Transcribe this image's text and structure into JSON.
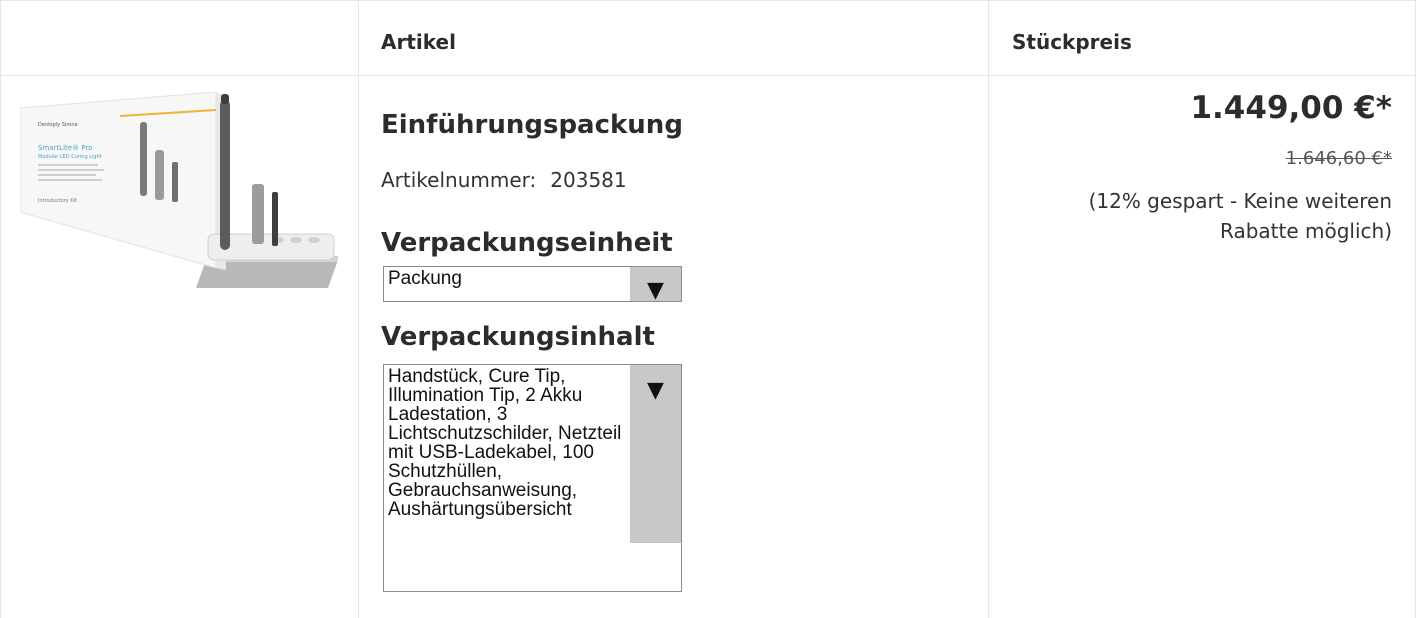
{
  "table": {
    "headers": {
      "image": "",
      "article": "Artikel",
      "unit_price": "Stückpreis"
    }
  },
  "product": {
    "title": "Einführungspackung",
    "article_number_label": "Artikelnummer:",
    "article_number": "203581",
    "image_alt": "SmartLite Pro Modular LED Curing Light Introductory Kit",
    "image_text": {
      "brand": "Dentsply Sirona",
      "name": "SmartLite® Pro",
      "subtitle": "Modular LED Curing Light",
      "kit": "Introductory Kit"
    },
    "packaging_unit": {
      "label": "Verpackungseinheit",
      "selected": "Packung"
    },
    "packaging_content": {
      "label": "Verpackungsinhalt",
      "text": "Handstück, Cure Tip, Illumination Tip, 2 Akku Ladestation, 3 Lichtschutzschilder, Netzteil mit USB-Ladekabel, 100 Schutzhüllen, Gebrauchsanweisung, Aushärtungsübersicht"
    }
  },
  "price": {
    "current": "1.449,00 €*",
    "original": "1.646,60 €*",
    "saving_note": "(12% gespart - Keine weiteren Rabatte möglich)"
  },
  "icons": {
    "dropdown": "dropdown-arrow-icon"
  }
}
